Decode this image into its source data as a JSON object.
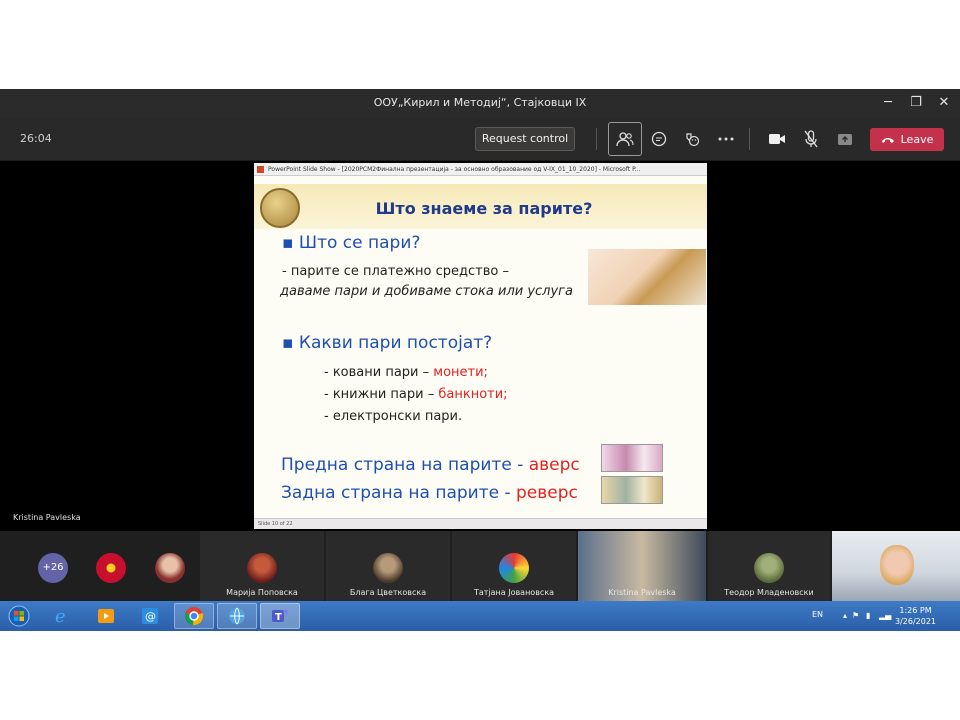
{
  "window": {
    "title": "ООУ„Кирил и Методиј“, Стајковци IX",
    "minimize": "─",
    "maximize": "❐",
    "close": "✕"
  },
  "toolbar": {
    "timer": "26:04",
    "request_control": "Request control",
    "leave": "Leave",
    "icons": [
      "people-icon",
      "chat-icon",
      "reactions-icon",
      "more-icon",
      "camera-icon",
      "mic-muted-icon",
      "share-icon"
    ],
    "leave_color": "#c4314b"
  },
  "presenter": {
    "name": "Kristina Pavleska"
  },
  "slideshow": {
    "window_title": "PowerPoint Slide Show - [2020РСМ2Финална презентација - за основно образование од V-IX_01_10_2020] - Microsoft P...",
    "status": "Slide 10 of 22",
    "slide": {
      "title": "Што знаеме за парите?",
      "q1": "▪ Што се пари?",
      "a1_line1": "- парите се платежно средство –",
      "a1_line2": "даваме пари и добиваме стока или услуга",
      "q2": "▪ Какви пари постојат?",
      "coins_prefix": "- ковани пари – ",
      "coins_value": "монети;",
      "notes_prefix": "- книжни пари – ",
      "notes_value": "банкноти;",
      "electronic": "- електронски пари.",
      "front_prefix": "Предна страна на парите - ",
      "front_value": "аверс",
      "back_prefix": "Задна страна на парите - ",
      "back_value": "реверс"
    }
  },
  "participants": {
    "overflow": "+26",
    "tiles": [
      {
        "name": "Марија Поповска"
      },
      {
        "name": "Блага Цветковска"
      },
      {
        "name": "Татјана Јовановска"
      },
      {
        "name": "Kristina Pavleska"
      },
      {
        "name": "Теодор Младеновски"
      }
    ]
  },
  "taskbar": {
    "language": "EN",
    "time": "1:26 PM",
    "date": "3/26/2021"
  }
}
